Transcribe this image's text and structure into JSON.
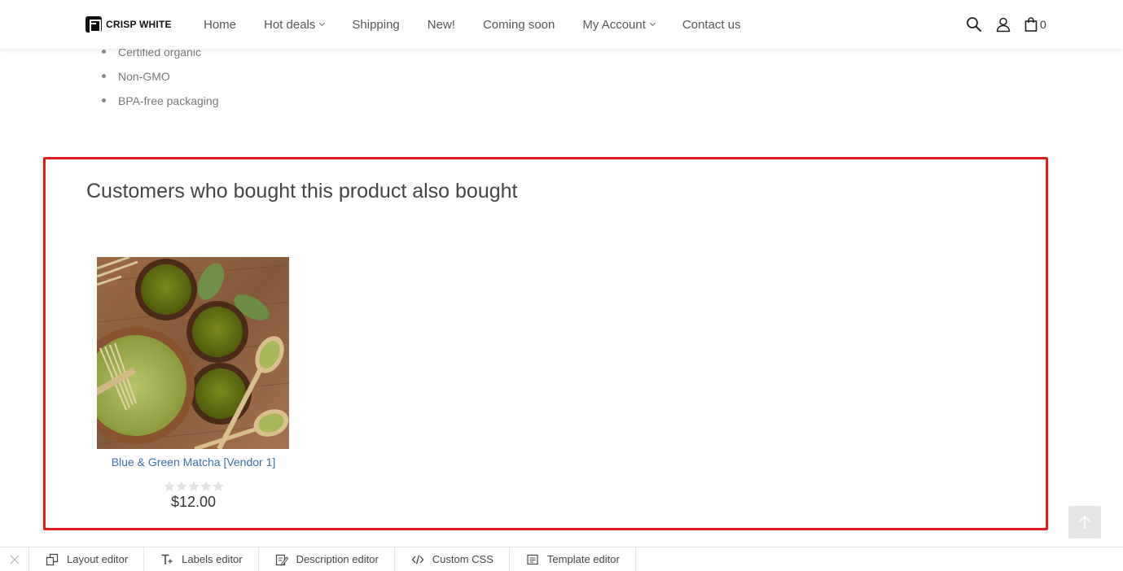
{
  "header": {
    "logo_text": "CRISP WHITE",
    "nav": [
      {
        "label": "Home",
        "has_dropdown": false
      },
      {
        "label": "Hot deals",
        "has_dropdown": true
      },
      {
        "label": "Shipping",
        "has_dropdown": false
      },
      {
        "label": "New!",
        "has_dropdown": false
      },
      {
        "label": "Coming soon",
        "has_dropdown": false
      },
      {
        "label": "My Account",
        "has_dropdown": true
      },
      {
        "label": "Contact us",
        "has_dropdown": false
      }
    ],
    "icons": [
      "search-icon",
      "user-icon",
      "shopping-bag-icon"
    ],
    "cart_count": "0"
  },
  "features": [
    "Certified organic",
    "Non-GMO",
    "BPA-free packaging"
  ],
  "also_bought": {
    "title": "Customers who bought this product also bought",
    "highlight_color": "#e31b1b",
    "products": [
      {
        "name": "Blue & Green Matcha [Vendor 1]",
        "price": "$12.00",
        "rating": 0,
        "rating_max": 5
      }
    ]
  },
  "back_to_top_icon": "arrow-up-icon",
  "editor_bar": {
    "close_icon": "close-icon",
    "buttons": [
      {
        "label": "Layout editor",
        "icon": "layout-icon"
      },
      {
        "label": "Labels editor",
        "icon": "text-plus-icon"
      },
      {
        "label": "Description editor",
        "icon": "edit-document-icon"
      },
      {
        "label": "Custom CSS",
        "icon": "code-icon"
      },
      {
        "label": "Template editor",
        "icon": "template-icon"
      }
    ]
  },
  "colors": {
    "link": "#3f6fa6",
    "nav_text": "#555555",
    "muted_text": "#777777"
  }
}
